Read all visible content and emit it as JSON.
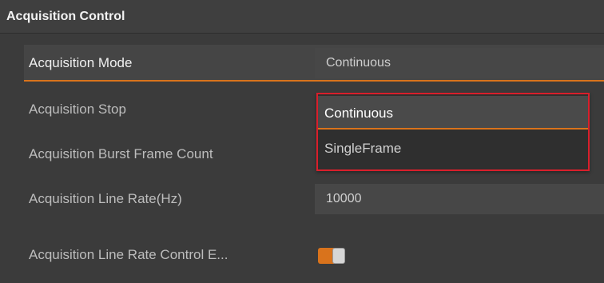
{
  "section": {
    "title": "Acquisition Control"
  },
  "rows": [
    {
      "label": "Acquisition Mode",
      "value": "Continuous"
    },
    {
      "label": "Acquisition Stop",
      "value": ""
    },
    {
      "label": "Acquisition Burst Frame Count",
      "value": ""
    },
    {
      "label": "Acquisition Line Rate(Hz)",
      "value": "10000"
    },
    {
      "label": "Acquisition Line Rate Control E...",
      "value": ""
    }
  ],
  "dropdown": {
    "options": [
      "Continuous",
      "SingleFrame"
    ],
    "highlighted": "Continuous"
  },
  "colors": {
    "accent": "#d9731c",
    "highlight_box": "#d91f2b",
    "background": "#3b3b3b"
  },
  "toggle": {
    "state": "on"
  }
}
